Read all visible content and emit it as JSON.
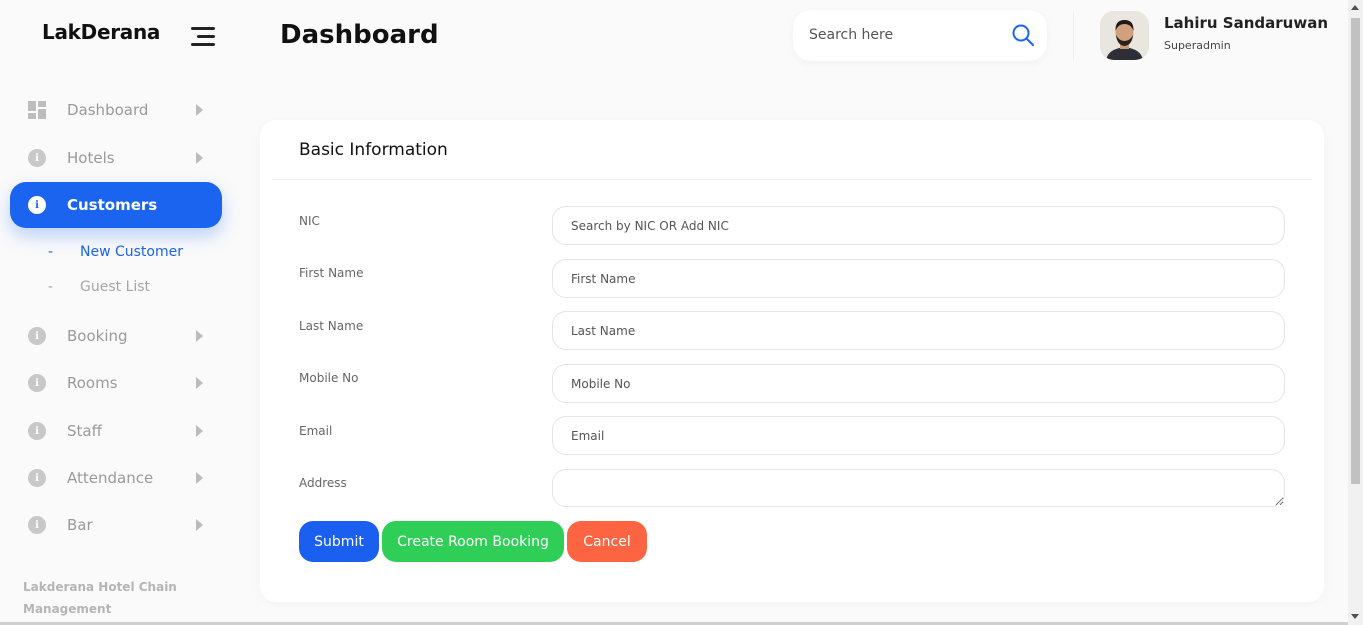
{
  "app": {
    "brand": "LakDerana",
    "page_title": "Dashboard"
  },
  "search": {
    "placeholder": "Search here"
  },
  "user": {
    "name": "Lahiru Sandaruwan",
    "role": "Superadmin"
  },
  "sidebar": {
    "items": [
      {
        "label": "Dashboard",
        "icon": "grid-icon"
      },
      {
        "label": "Hotels",
        "icon": "info-icon"
      },
      {
        "label": "Customers",
        "icon": "info-icon",
        "active": true
      },
      {
        "label": "Booking",
        "icon": "info-icon"
      },
      {
        "label": "Rooms",
        "icon": "info-icon"
      },
      {
        "label": "Staff",
        "icon": "info-icon"
      },
      {
        "label": "Attendance",
        "icon": "info-icon"
      },
      {
        "label": "Bar",
        "icon": "info-icon"
      }
    ],
    "sub_items": [
      {
        "label": "New Customer",
        "active": true
      },
      {
        "label": "Guest List",
        "active": false
      }
    ],
    "footer": "Lakderana Hotel Chain Management"
  },
  "form": {
    "title": "Basic Information",
    "fields": [
      {
        "label": "NIC",
        "placeholder": "Search by NIC OR Add NIC"
      },
      {
        "label": "First Name",
        "placeholder": "First Name"
      },
      {
        "label": "Last Name",
        "placeholder": "Last Name"
      },
      {
        "label": "Mobile No",
        "placeholder": "Mobile No"
      },
      {
        "label": "Email",
        "placeholder": "Email"
      },
      {
        "label": "Address",
        "placeholder": ""
      }
    ],
    "buttons": {
      "submit": "Submit",
      "create_booking": "Create Room Booking",
      "cancel": "Cancel"
    }
  },
  "colors": {
    "primary": "#1a64f0",
    "success": "#2fcf57",
    "danger": "#fd6442"
  }
}
